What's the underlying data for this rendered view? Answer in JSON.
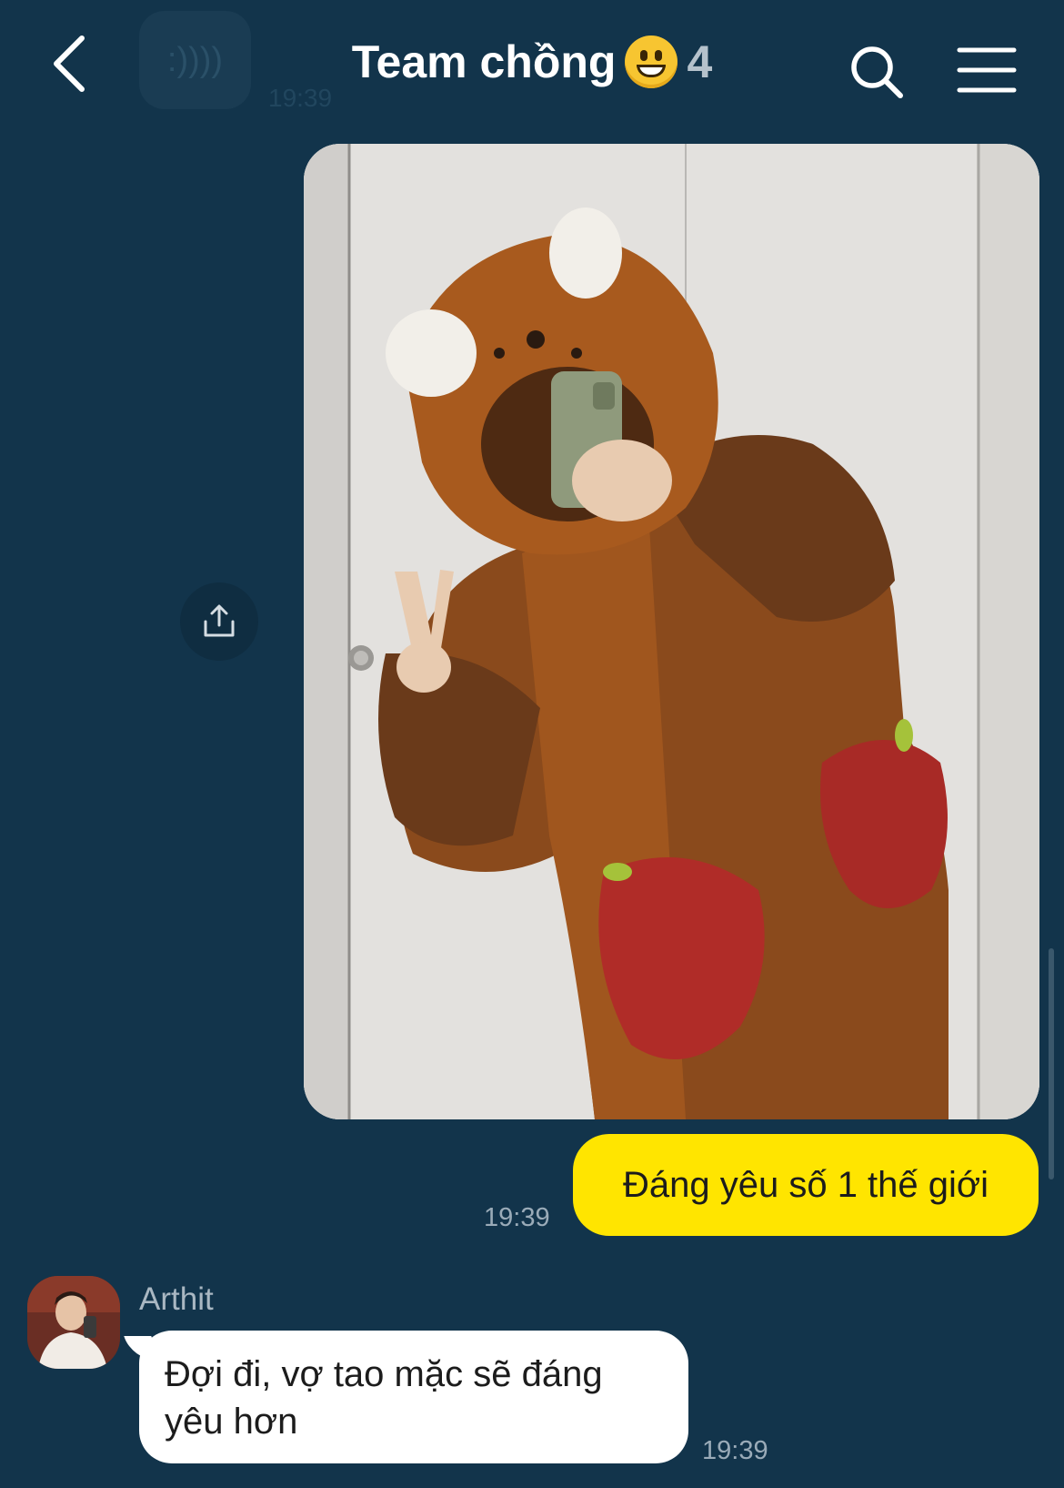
{
  "header": {
    "title": "Team chồng",
    "emoji": "grinning-face",
    "member_count": "4",
    "back_icon": "chevron-left-icon",
    "search_icon": "search-icon",
    "menu_icon": "hamburger-menu-icon"
  },
  "background_preview": {
    "text": ":))))",
    "time": "19:39"
  },
  "messages": {
    "photo": {
      "description_icon": "image"
    },
    "outgoing": {
      "text": "Đáng yêu số 1 thế giới",
      "time": "19:39"
    },
    "incoming": {
      "sender": "Arthit",
      "text": "Đợi đi, vợ tao mặc sẽ đáng yêu hơn",
      "time": "19:39"
    }
  },
  "colors": {
    "background": "#12344b",
    "outgoing_bubble": "#ffe500",
    "incoming_bubble": "#ffffff"
  }
}
